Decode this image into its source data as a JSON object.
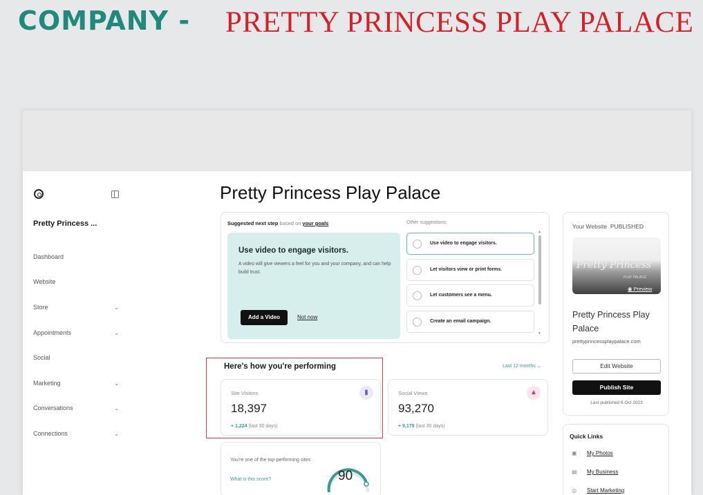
{
  "banner": {
    "left": "COMPANY -",
    "right": "PRETTY PRINCESS PLAY PALACE"
  },
  "sidebar": {
    "business_name": "Pretty Princess ...",
    "items": [
      {
        "label": "Dashboard",
        "chevron": false
      },
      {
        "label": "Website",
        "chevron": false
      },
      {
        "label": "Store",
        "chevron": true
      },
      {
        "label": "Appointments",
        "chevron": true
      },
      {
        "label": "Social",
        "chevron": false
      },
      {
        "label": "Marketing",
        "chevron": true
      },
      {
        "label": "Conversations",
        "chevron": true
      },
      {
        "label": "Connections",
        "chevron": true
      }
    ]
  },
  "main": {
    "title": "Pretty Princess Play Palace"
  },
  "suggestion": {
    "heading": "Suggested next step",
    "heading_light": "based on",
    "heading_link": "your goals",
    "card_title": "Use video to engage visitors.",
    "card_desc": "A video will give viewers a feel for you and your company, and can help build trust.",
    "primary_button": "Add a Video",
    "secondary_link": "Not now",
    "other_label": "Other suggestions:",
    "options": [
      "Use video to engage visitors.",
      "Let visitors view or print forms.",
      "Let customers see a menu.",
      "Create an email campaign."
    ]
  },
  "performance": {
    "title": "Here's how you're performing",
    "period": "Last 12 months",
    "site_visitors": {
      "label": "Site Visitors",
      "value": "18,397",
      "change": "+ 1,224",
      "change_note": "(last 30 days)"
    },
    "social_views": {
      "label": "Social Views",
      "value": "93,270",
      "change": "+ 9,179",
      "change_note": "(last 30 days)"
    },
    "score": {
      "message": "You're one of the top-performing sites",
      "link": "What is this score?",
      "value": "90"
    }
  },
  "site_panel": {
    "label": "Your Website",
    "status": "PUBLISHED",
    "thumb_text": "Pretty Princess",
    "thumb_tag": "PLAY PALACE",
    "preview_link": "Preview",
    "name": "Pretty Princess Play Palace",
    "url": "prettyprincessplaypalace.com",
    "edit_button": "Edit Website",
    "publish_button": "Publish Site",
    "last_published": "Last published 6 Oct 2023"
  },
  "quick_links": {
    "title": "Quick Links",
    "items": [
      "My Photos",
      "My Business",
      "Start Marketing"
    ]
  },
  "colors": {
    "teal": "#1f8a7c",
    "red": "#d3232a",
    "card_bg": "#d6eeec",
    "highlight": "#e23a3a"
  }
}
